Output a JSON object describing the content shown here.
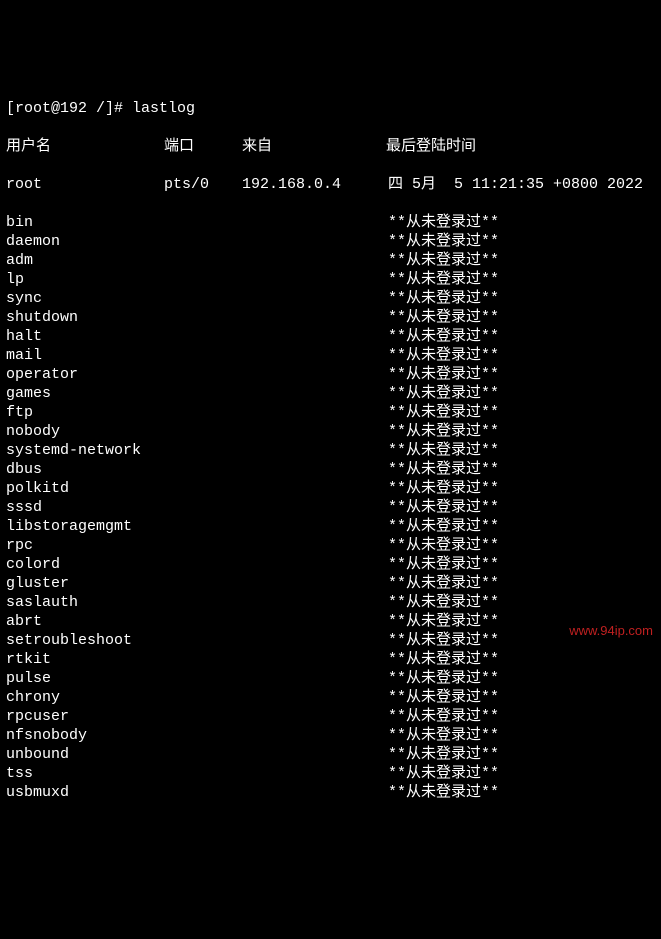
{
  "topline": "[root@192 /]# lastlog",
  "header": {
    "user": "用户名",
    "port": "端口",
    "from": "来自",
    "last": "最后登陆时间"
  },
  "never": "**从未登录过**",
  "root_entry": {
    "user": "root",
    "port": "pts/0",
    "from": "192.168.0.4",
    "last": "四 5月  5 11:21:35 +0800 2022"
  },
  "users": [
    "bin",
    "daemon",
    "adm",
    "lp",
    "sync",
    "shutdown",
    "halt",
    "mail",
    "operator",
    "games",
    "ftp",
    "nobody",
    "systemd-network",
    "dbus",
    "polkitd",
    "sssd",
    "libstoragemgmt",
    "rpc",
    "colord",
    "gluster",
    "saslauth",
    "abrt",
    "setroubleshoot",
    "rtkit",
    "pulse",
    "chrony",
    "rpcuser",
    "nfsnobody",
    "unbound",
    "tss",
    "usbmuxd"
  ],
  "watermark": "www.94ip.com"
}
